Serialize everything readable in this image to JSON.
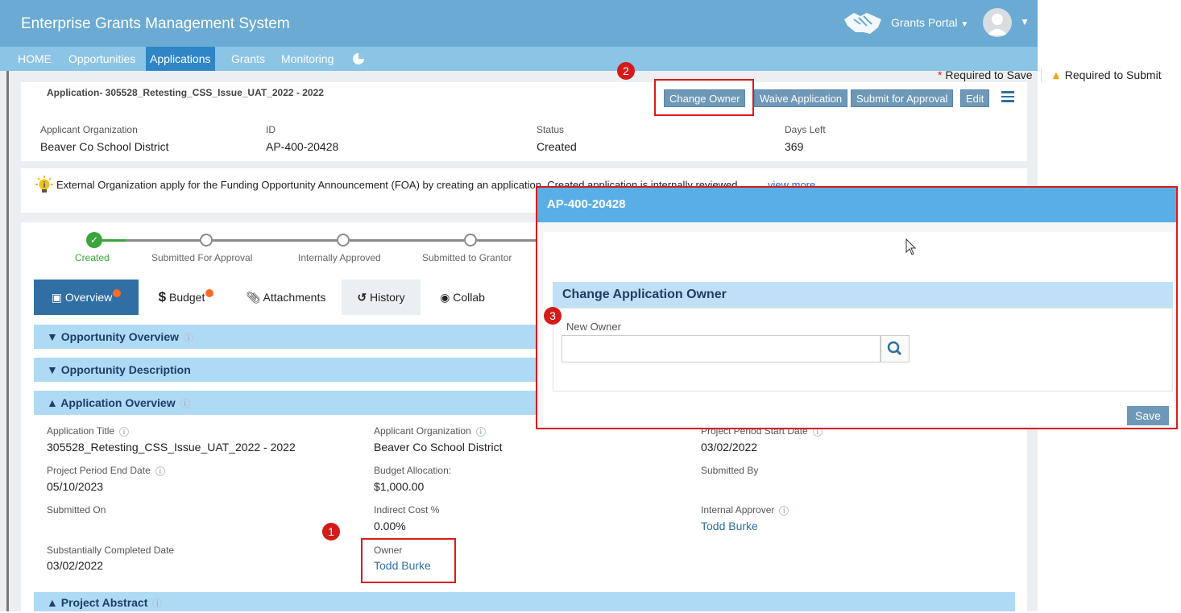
{
  "header": {
    "app_title": "Enterprise Grants Management System",
    "portal_label": "Grants Portal",
    "portal_icon": "handshake-icon",
    "user_icon": "user-avatar-icon"
  },
  "nav": {
    "items": [
      "HOME",
      "Opportunities",
      "Applications",
      "Grants",
      "Monitoring"
    ],
    "active": "Applications"
  },
  "application": {
    "heading": "Application- 305528_Retesting_CSS_Issue_UAT_2022 - 2022",
    "buttons": {
      "change_owner": "Change Owner",
      "waive": "Waive Application",
      "submit": "Submit for Approval",
      "edit": "Edit"
    },
    "meta": [
      {
        "label": "Applicant Organization",
        "value": "Beaver Co School District"
      },
      {
        "label": "ID",
        "value": "AP-400-20428"
      },
      {
        "label": "Status",
        "value": "Created"
      },
      {
        "label": "Days Left",
        "value": "369"
      }
    ]
  },
  "info_banner": {
    "text": "External Organization apply for the Funding Opportunity Announcement (FOA) by creating an application. Created application is internally reviewed",
    "link": "view more"
  },
  "progress": {
    "steps": [
      "Created",
      "Submitted For Approval",
      "Internally Approved",
      "Submitted to Grantor"
    ],
    "current": "Created"
  },
  "tabs": {
    "items": [
      "Overview",
      "Budget",
      "Attachments",
      "History",
      "Collab"
    ],
    "active": "Overview",
    "dollar": "$"
  },
  "sections": {
    "opportunity_overview": "Opportunity Overview",
    "opportunity_description": "Opportunity Description",
    "application_overview": "Application Overview",
    "project_abstract": "Project Abstract"
  },
  "fields": {
    "application_title": {
      "label": "Application Title",
      "value": "305528_Retesting_CSS_Issue_UAT_2022 - 2022"
    },
    "applicant_org": {
      "label": "Applicant Organization",
      "value": "Beaver Co School District"
    },
    "project_start": {
      "label": "Project Period Start Date",
      "value": "03/02/2022"
    },
    "project_end": {
      "label": "Project Period End Date",
      "value": "05/10/2023"
    },
    "budget_allocation": {
      "label": "Budget Allocation:",
      "value": "$1,000.00"
    },
    "submitted_by": {
      "label": "Submitted By",
      "value": ""
    },
    "submitted_on": {
      "label": "Submitted On",
      "value": ""
    },
    "indirect_cost": {
      "label": "Indirect Cost %",
      "value": "0.00%"
    },
    "internal_approver": {
      "label": "Internal Approver",
      "value": "Todd Burke"
    },
    "substantially_completed": {
      "label": "Substantially Completed Date",
      "value": "03/02/2022"
    },
    "owner": {
      "label": "Owner",
      "value": "Todd Burke"
    }
  },
  "markers": [
    "1",
    "2",
    "3"
  ],
  "modal": {
    "title": "AP-400-20428",
    "required_to_save": "Required to Save",
    "required_to_submit": "Required to Submit",
    "section_title": "Change Application Owner",
    "new_owner_label": "New Owner",
    "new_owner_value": "",
    "save": "Save"
  },
  "colors": {
    "topbar": "#6aaad3",
    "nav_active": "#2f86c7",
    "section_header": "#aedaf5",
    "button": "#6e98b8",
    "highlight": "#d81b1b",
    "link": "#2f6fa3"
  }
}
